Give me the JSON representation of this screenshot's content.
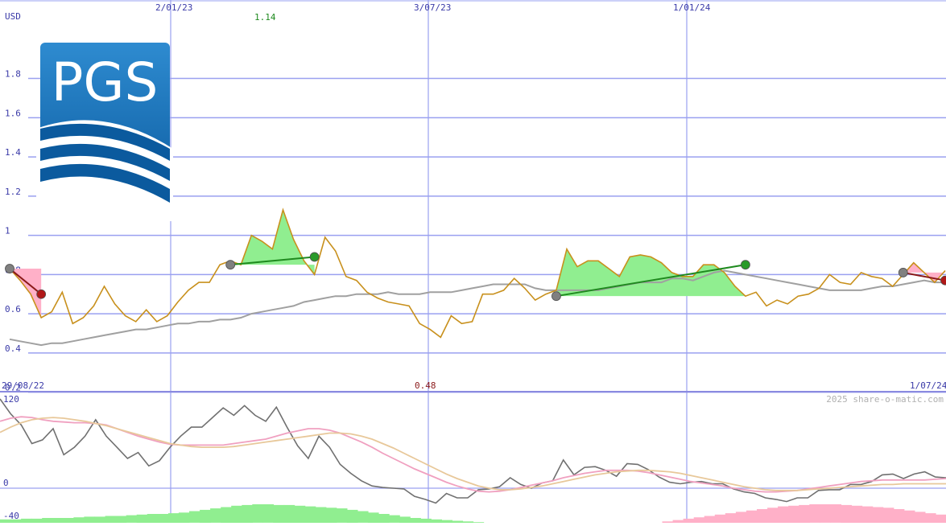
{
  "chart_data": [
    {
      "type": "line",
      "unit_label": "USD",
      "y_ticks": [
        "1.8",
        "1.6",
        "1.4",
        "1.2",
        "1",
        "0.8",
        "0.6",
        "0.4",
        "0.2"
      ],
      "y_tick_values": [
        1.8,
        1.6,
        1.4,
        1.2,
        1.0,
        0.8,
        0.6,
        0.4,
        0.2
      ],
      "ylim": [
        0.15,
        1.85
      ],
      "x_ticks_top": [
        "2/01/23",
        "3/07/23",
        "1/01/24"
      ],
      "x_ticks_bottom": [
        "29/08/22",
        "0.48",
        "1/07/24"
      ],
      "period_start": "29/08/22",
      "period_end": "1/07/24",
      "max_label": "1.14",
      "min_label": "0.48",
      "max_label_color": "#1f8a1f",
      "min_label_color": "#8b1a1a",
      "grid": true,
      "logo_text": "PGS",
      "series": [
        {
          "color": "#c8901c",
          "values": [
            0.83,
            0.77,
            0.7,
            0.58,
            0.61,
            0.71,
            0.55,
            0.58,
            0.64,
            0.74,
            0.65,
            0.59,
            0.56,
            0.62,
            0.56,
            0.59,
            0.66,
            0.72,
            0.76,
            0.76,
            0.85,
            0.87,
            0.85,
            1.0,
            0.97,
            0.93,
            1.13,
            0.98,
            0.87,
            0.8,
            0.99,
            0.92,
            0.79,
            0.77,
            0.71,
            0.68,
            0.66,
            0.65,
            0.64,
            0.55,
            0.52,
            0.48,
            0.59,
            0.55,
            0.56,
            0.7,
            0.7,
            0.72,
            0.78,
            0.73,
            0.67,
            0.7,
            0.72,
            0.93,
            0.84,
            0.87,
            0.87,
            0.83,
            0.79,
            0.89,
            0.9,
            0.89,
            0.86,
            0.81,
            0.79,
            0.79,
            0.85,
            0.85,
            0.81,
            0.74,
            0.69,
            0.71,
            0.64,
            0.67,
            0.65,
            0.69,
            0.7,
            0.73,
            0.8,
            0.76,
            0.75,
            0.81,
            0.79,
            0.78,
            0.74,
            0.8,
            0.86,
            0.81,
            0.76,
            0.82
          ]
        },
        {
          "color": "#a0a0a0",
          "values": [
            0.47,
            0.46,
            0.45,
            0.44,
            0.45,
            0.45,
            0.46,
            0.47,
            0.48,
            0.49,
            0.5,
            0.51,
            0.52,
            0.52,
            0.53,
            0.54,
            0.55,
            0.55,
            0.56,
            0.56,
            0.57,
            0.57,
            0.58,
            0.6,
            0.61,
            0.62,
            0.63,
            0.64,
            0.66,
            0.67,
            0.68,
            0.69,
            0.69,
            0.7,
            0.7,
            0.7,
            0.71,
            0.7,
            0.7,
            0.7,
            0.71,
            0.71,
            0.71,
            0.72,
            0.73,
            0.74,
            0.75,
            0.75,
            0.75,
            0.75,
            0.73,
            0.72,
            0.72,
            0.72,
            0.72,
            0.72,
            0.72,
            0.73,
            0.74,
            0.75,
            0.76,
            0.76,
            0.76,
            0.78,
            0.78,
            0.77,
            0.79,
            0.81,
            0.82,
            0.81,
            0.8,
            0.79,
            0.78,
            0.77,
            0.76,
            0.75,
            0.74,
            0.73,
            0.72,
            0.72,
            0.72,
            0.72,
            0.73,
            0.74,
            0.74,
            0.75,
            0.76,
            0.77,
            0.76,
            0.76
          ]
        }
      ],
      "trades": [
        {
          "type": "loss",
          "start_index": 0,
          "end_index": 3,
          "start_value": 0.83,
          "end_value": 0.7,
          "start_dot": "#808080",
          "end_dot": "#b01818"
        },
        {
          "type": "gain",
          "start_index": 21,
          "end_index": 29,
          "start_value": 0.85,
          "end_value": 0.89,
          "start_dot": "#808080",
          "end_dot": "#2a9a2a"
        },
        {
          "type": "gain",
          "start_index": 52,
          "end_index": 70,
          "start_value": 0.69,
          "end_value": 0.85,
          "start_dot": "#808080",
          "end_dot": "#2a9a2a"
        },
        {
          "type": "loss",
          "start_index": 85,
          "end_index": 89,
          "start_value": 0.81,
          "end_value": 0.77,
          "start_dot": "#808080",
          "end_dot": "#b01818"
        }
      ],
      "trade_colors": {
        "gain_fill": "#90ee90",
        "loss_fill": "#ffb0c8",
        "gain_line": "#1f8a1f",
        "loss_line": "#8b1a1a"
      }
    },
    {
      "type": "line",
      "y_ticks": [
        "120",
        "0",
        "-40"
      ],
      "y_tick_values": [
        120,
        0,
        -40
      ],
      "ylim": [
        -42,
        125
      ],
      "watermark": "2025 share-o-matic.com",
      "grid": true,
      "series": [
        {
          "color": "#707070",
          "values": [
            120,
            100,
            85,
            60,
            65,
            80,
            45,
            55,
            70,
            92,
            70,
            55,
            40,
            48,
            30,
            37,
            55,
            70,
            82,
            82,
            95,
            108,
            98,
            111,
            98,
            90,
            109,
            82,
            57,
            40,
            70,
            55,
            32,
            20,
            10,
            3,
            1,
            0,
            -1,
            -11,
            -15,
            -20,
            -7,
            -13,
            -13,
            -2,
            -1,
            2,
            14,
            5,
            0,
            7,
            10,
            38,
            18,
            28,
            29,
            24,
            16,
            33,
            32,
            25,
            15,
            8,
            6,
            8,
            9,
            6,
            6,
            -1,
            -5,
            -7,
            -13,
            -15,
            -18,
            -13,
            -13,
            -3,
            -2,
            -2,
            5,
            5,
            9,
            18,
            19,
            13,
            19,
            22,
            15,
            14
          ]
        },
        {
          "color": "#f0a0c0",
          "values": [
            90,
            94,
            96,
            95,
            92,
            90,
            89,
            88,
            88,
            87,
            85,
            80,
            75,
            70,
            66,
            62,
            59,
            58,
            58,
            58,
            58,
            58,
            60,
            62,
            64,
            66,
            70,
            74,
            77,
            80,
            80,
            78,
            74,
            68,
            62,
            55,
            47,
            40,
            33,
            26,
            20,
            14,
            8,
            3,
            -1,
            -4,
            -5,
            -4,
            -2,
            1,
            4,
            7,
            10,
            14,
            17,
            20,
            22,
            24,
            24,
            24,
            23,
            21,
            18,
            15,
            12,
            9,
            7,
            5,
            3,
            0,
            -2,
            -4,
            -5,
            -5,
            -4,
            -3,
            -1,
            1,
            3,
            5,
            7,
            9,
            10,
            11,
            11,
            11,
            11,
            11,
            12,
            13
          ]
        },
        {
          "color": "#e8c89a",
          "values": [
            75,
            82,
            88,
            92,
            94,
            95,
            94,
            92,
            90,
            87,
            84,
            80,
            76,
            72,
            68,
            64,
            60,
            58,
            56,
            55,
            55,
            55,
            56,
            58,
            60,
            62,
            64,
            66,
            68,
            70,
            72,
            74,
            74,
            73,
            70,
            66,
            60,
            54,
            47,
            40,
            33,
            26,
            19,
            13,
            8,
            3,
            0,
            -2,
            -2,
            -1,
            1,
            3,
            6,
            9,
            12,
            15,
            18,
            20,
            22,
            23,
            24,
            24,
            23,
            22,
            20,
            17,
            14,
            11,
            8,
            5,
            2,
            0,
            -2,
            -3,
            -3,
            -3,
            -2,
            -1,
            0,
            1,
            2,
            3,
            4,
            5,
            5,
            6,
            6,
            6,
            6,
            6
          ]
        }
      ],
      "histogram": {
        "positive_color": "#90ee90",
        "negative_color": "#ffb0c8",
        "values": [
          5,
          5,
          6,
          6,
          7,
          7,
          7,
          8,
          9,
          9,
          10,
          10,
          11,
          12,
          13,
          13,
          14,
          15,
          17,
          19,
          21,
          23,
          25,
          26,
          27,
          27,
          26,
          26,
          25,
          24,
          23,
          22,
          21,
          19,
          17,
          15,
          13,
          11,
          9,
          7,
          6,
          5,
          4,
          3,
          2,
          1,
          0,
          0,
          0,
          0,
          0,
          0,
          0,
          0,
          0,
          0,
          0,
          0,
          0,
          0,
          0,
          0,
          0,
          -2,
          -4,
          -6,
          -8,
          -10,
          -12,
          -14,
          -16,
          -18,
          -20,
          -22,
          -24,
          -25,
          -26,
          -27,
          -27,
          -27,
          -26,
          -25,
          -24,
          -23,
          -22,
          -20,
          -18,
          -16,
          -14,
          -12
        ]
      }
    }
  ]
}
